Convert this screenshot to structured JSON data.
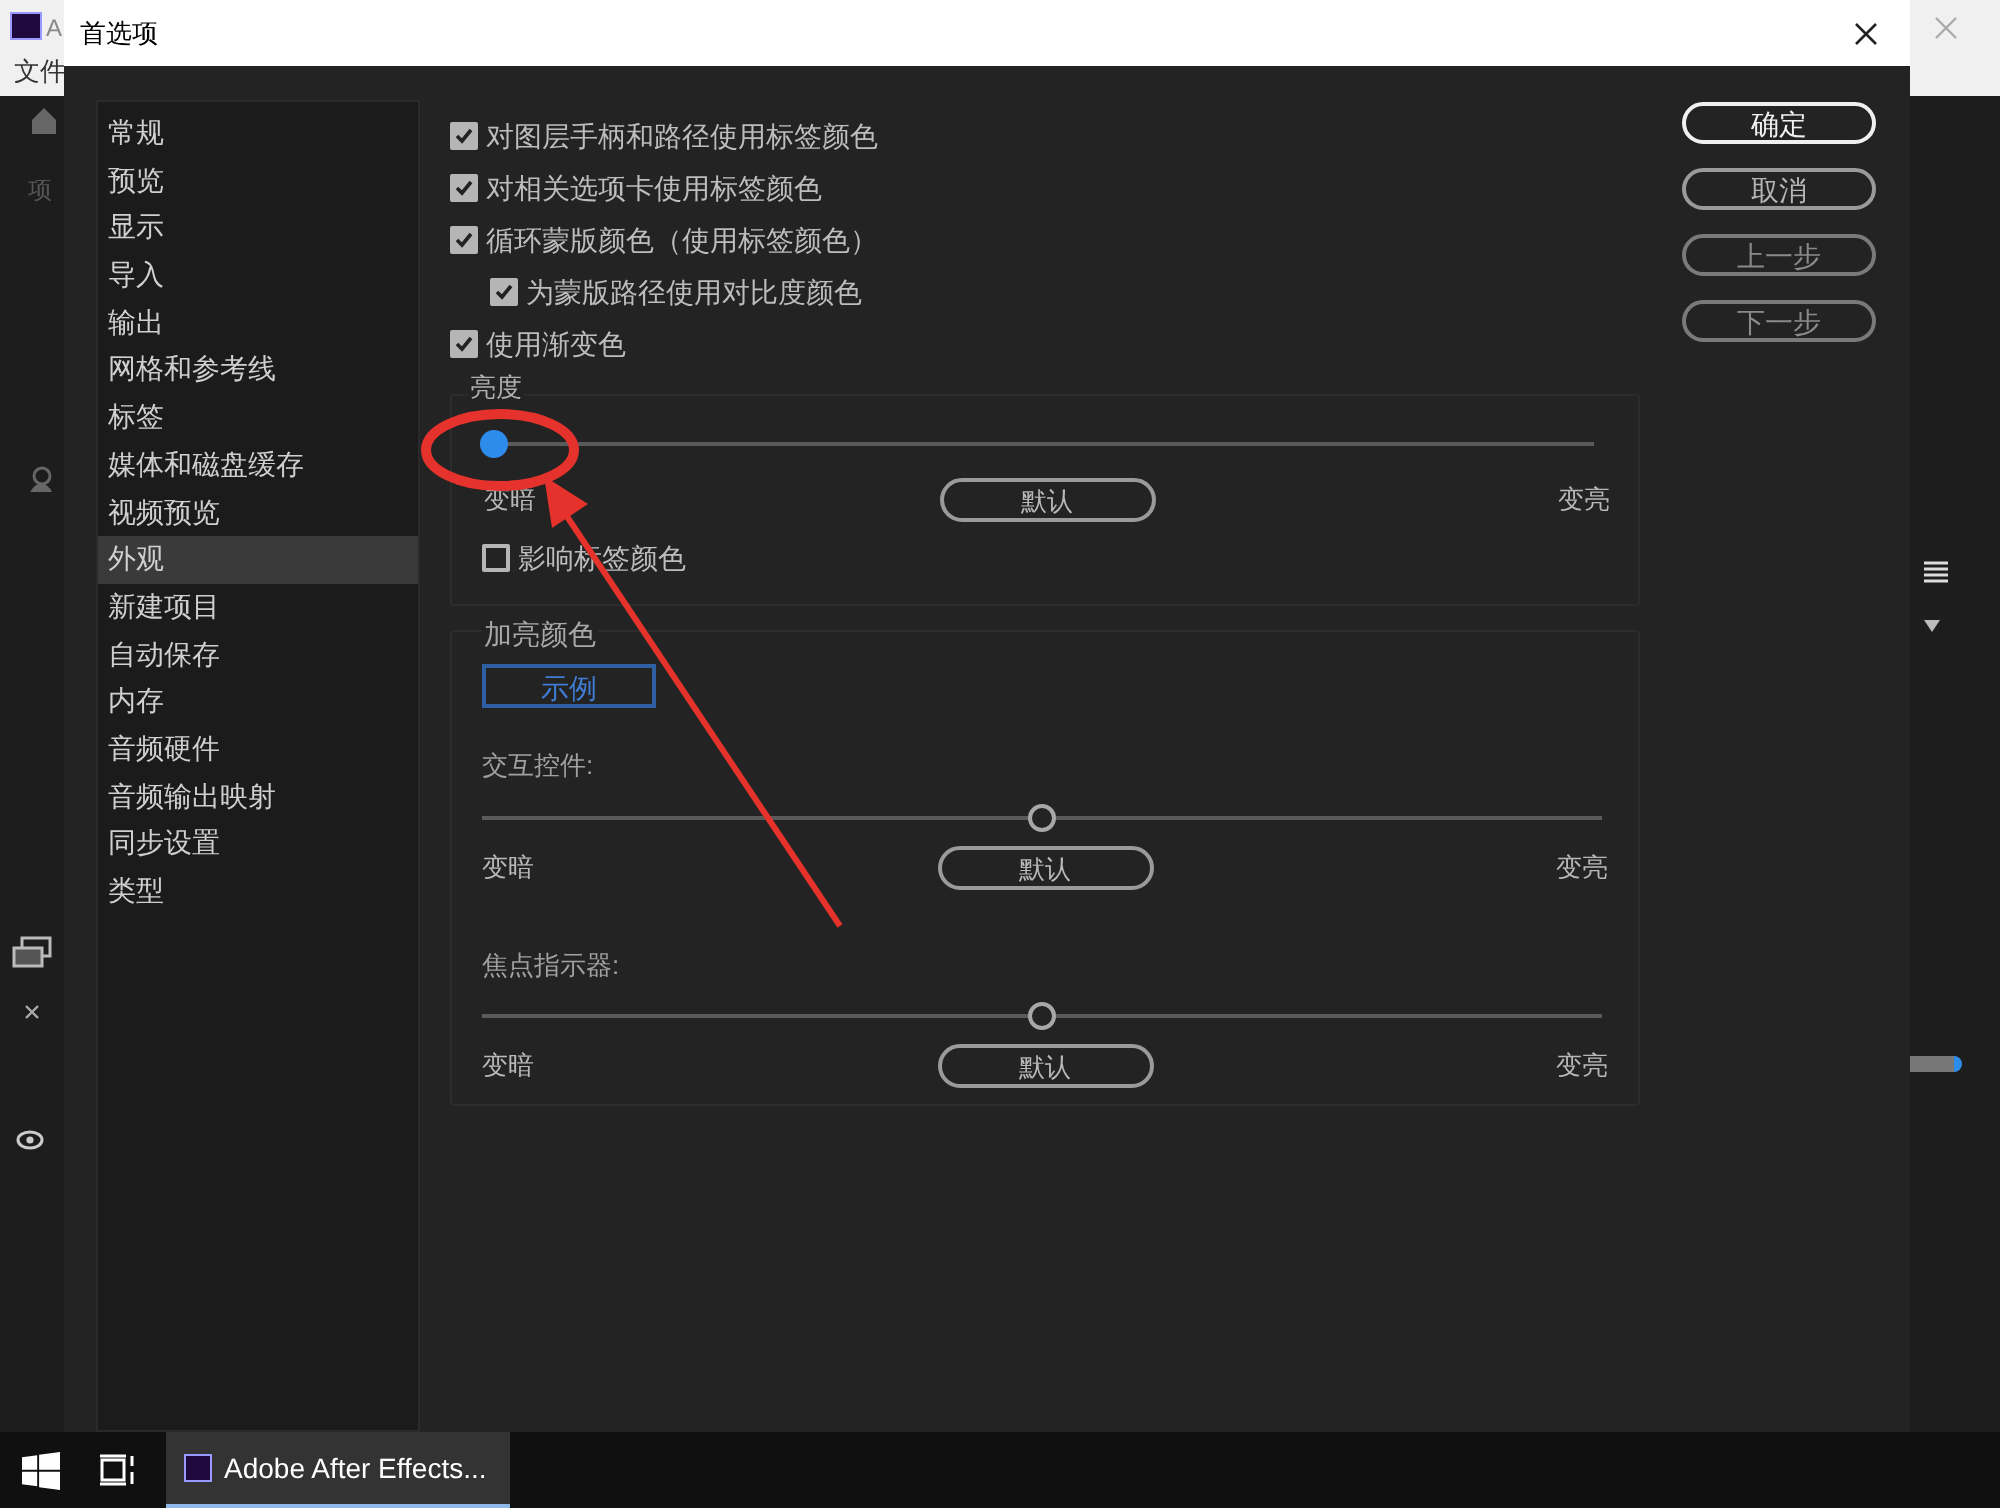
{
  "app": {
    "title": "A",
    "menu": "文件",
    "panel": "项"
  },
  "dialog": {
    "title": "首选项"
  },
  "sidebar": {
    "items": [
      {
        "label": "常规",
        "selected": false
      },
      {
        "label": "预览",
        "selected": false
      },
      {
        "label": "显示",
        "selected": false
      },
      {
        "label": "导入",
        "selected": false
      },
      {
        "label": "输出",
        "selected": false
      },
      {
        "label": "网格和参考线",
        "selected": false
      },
      {
        "label": "标签",
        "selected": false
      },
      {
        "label": "媒体和磁盘缓存",
        "selected": false
      },
      {
        "label": "视频预览",
        "selected": false
      },
      {
        "label": "外观",
        "selected": true
      },
      {
        "label": "新建项目",
        "selected": false
      },
      {
        "label": "自动保存",
        "selected": false
      },
      {
        "label": "内存",
        "selected": false
      },
      {
        "label": "音频硬件",
        "selected": false
      },
      {
        "label": "音频输出映射",
        "selected": false
      },
      {
        "label": "同步设置",
        "selected": false
      },
      {
        "label": "类型",
        "selected": false
      }
    ]
  },
  "options": [
    {
      "label": "对图层手柄和路径使用标签颜色",
      "checked": true
    },
    {
      "label": "对相关选项卡使用标签颜色",
      "checked": true
    },
    {
      "label": "循环蒙版颜色（使用标签颜色）",
      "checked": true,
      "children": [
        {
          "label": "为蒙版路径使用对比度颜色",
          "checked": true
        }
      ]
    },
    {
      "label": "使用渐变色",
      "checked": true
    }
  ],
  "brightness": {
    "title": "亮度",
    "slider": {
      "level": 0,
      "focused": true,
      "min_label": "变暗",
      "default_button": "默认",
      "max_label": "变亮"
    },
    "affect_labels": {
      "label": "影响标签颜色",
      "checked": false
    }
  },
  "highlight": {
    "title": "加亮颜色",
    "sample_button": "示例",
    "sliders": [
      {
        "label": "交互控件:",
        "level": 0.5,
        "focused": false,
        "min_label": "变暗",
        "default_button": "默认",
        "max_label": "变亮"
      },
      {
        "label": "焦点指示器:",
        "level": 0.5,
        "focused": false,
        "min_label": "变暗",
        "default_button": "默认",
        "max_label": "变亮"
      }
    ]
  },
  "buttons": [
    {
      "label": "确定",
      "default": true,
      "disabled": false
    },
    {
      "label": "取消",
      "default": false,
      "disabled": false
    },
    {
      "label": "上一步",
      "default": false,
      "disabled": true
    },
    {
      "label": "下一步",
      "default": false,
      "disabled": true
    }
  ],
  "taskbar": {
    "app_button": {
      "label": "Adobe After Effects...",
      "selected": true
    }
  }
}
